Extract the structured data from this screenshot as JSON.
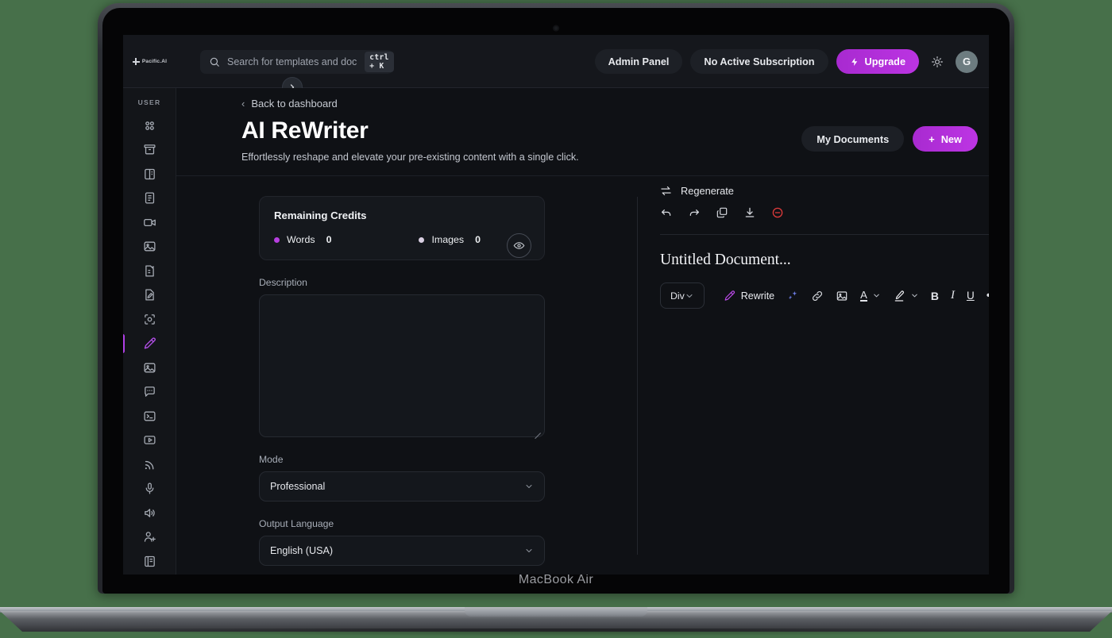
{
  "device": {
    "model_label": "MacBook Air"
  },
  "topbar": {
    "logo_text": "Pacific.AI",
    "search": {
      "placeholder": "Search for templates and doc",
      "shortcut": "ctrl + K"
    },
    "admin_panel": "Admin Panel",
    "subscription": "No Active Subscription",
    "upgrade": "Upgrade",
    "avatar_initial": "G"
  },
  "sidebar": {
    "section_label": "USER",
    "items": [
      {
        "name": "dashboard-grid",
        "label": "Dashboard"
      },
      {
        "name": "archive",
        "label": "Archive"
      },
      {
        "name": "panel-layout",
        "label": "Templates"
      },
      {
        "name": "document",
        "label": "Documents"
      },
      {
        "name": "video",
        "label": "Video"
      },
      {
        "name": "image",
        "label": "Images"
      },
      {
        "name": "ai-document",
        "label": "AI Article"
      },
      {
        "name": "edit-document",
        "label": "AI ReWriter Doc"
      },
      {
        "name": "scan-face",
        "label": "Vision"
      },
      {
        "name": "pencil",
        "label": "AI ReWriter"
      },
      {
        "name": "photo",
        "label": "AI Image"
      },
      {
        "name": "chat",
        "label": "Chat"
      },
      {
        "name": "terminal",
        "label": "Code"
      },
      {
        "name": "play-box",
        "label": "Media"
      },
      {
        "name": "rss",
        "label": "Feed"
      },
      {
        "name": "microphone",
        "label": "Speech to Text"
      },
      {
        "name": "speaker",
        "label": "Text to Speech"
      },
      {
        "name": "add-user",
        "label": "Invite"
      },
      {
        "name": "book",
        "label": "Docs"
      }
    ],
    "active_index": 9
  },
  "page": {
    "back_label": "Back to dashboard",
    "title": "AI ReWriter",
    "subtitle": "Effortlessly reshape and elevate your pre-existing content with a single click.",
    "my_documents": "My Documents",
    "new_button": "New",
    "new_plus": "+"
  },
  "credits": {
    "title": "Remaining Credits",
    "words_label": "Words",
    "words_value": "0",
    "images_label": "Images",
    "images_value": "0",
    "eye_icon": "eye-icon"
  },
  "form": {
    "description_label": "Description",
    "description_value": "",
    "description_placeholder": "",
    "mode_label": "Mode",
    "mode_value": "Professional",
    "language_label": "Output Language",
    "language_value": "English (USA)"
  },
  "editor": {
    "regenerate": "Regenerate",
    "actions": [
      {
        "name": "undo-icon",
        "label": "Undo"
      },
      {
        "name": "redo-icon",
        "label": "Redo"
      },
      {
        "name": "copy-icon",
        "label": "Copy"
      },
      {
        "name": "download-icon",
        "label": "Download"
      },
      {
        "name": "delete-icon",
        "label": "Delete"
      }
    ],
    "doc_title": "Untitled Document...",
    "block_type": "Div",
    "rewrite_label": "Rewrite",
    "bold": "B",
    "italic": "I",
    "underline": "U",
    "more": "•••",
    "text_color_glyph": "A",
    "toolbar_icons": [
      {
        "name": "magic-sparkle-icon"
      },
      {
        "name": "link-icon"
      },
      {
        "name": "image-icon"
      },
      {
        "name": "text-color-icon"
      },
      {
        "name": "highlighter-icon"
      }
    ]
  },
  "colors": {
    "accent_purple": "#b040e6",
    "screen_bg": "#0f1115",
    "panel_bg": "#15181d",
    "danger_red": "#e03b3b",
    "desktop_bg": "#47704a"
  }
}
